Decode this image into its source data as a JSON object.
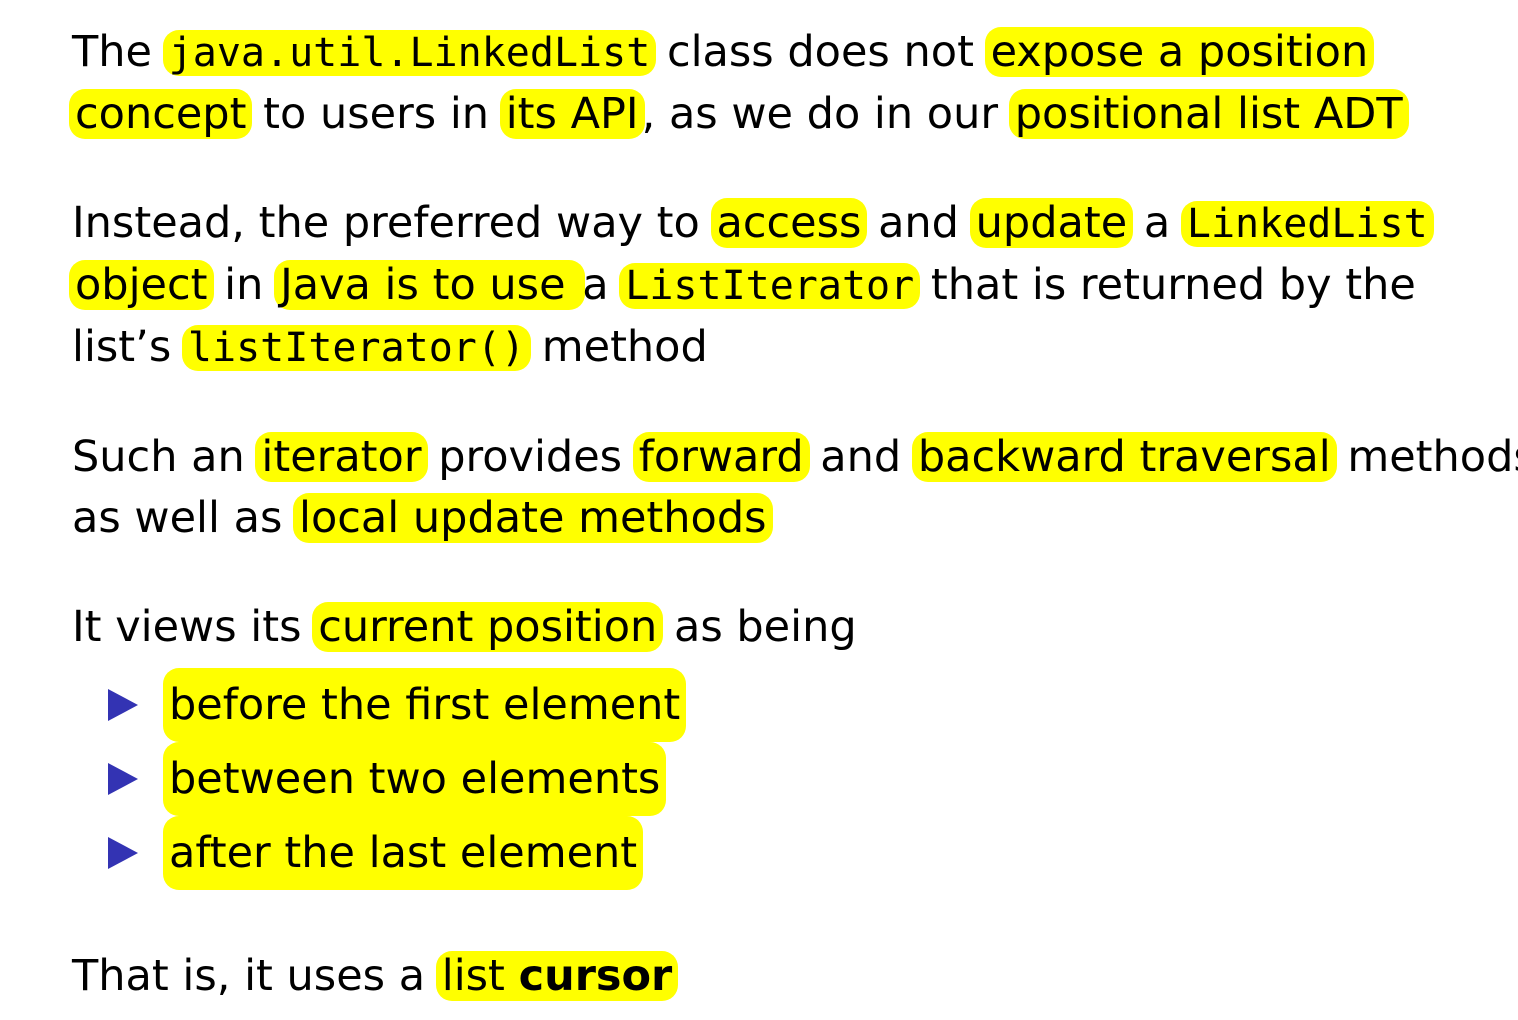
{
  "p1": {
    "t1": "The ",
    "h1": "java.util.LinkedList",
    "t2": " class does not ",
    "h2": "expose a position",
    "h3": "concept",
    "t3": " to users in ",
    "h4": "its API",
    "t4": ", as we do in our ",
    "h5": "positional list ADT"
  },
  "p2": {
    "t1": "Instead, the preferred way to ",
    "h1": "access",
    "t2": " and ",
    "h2": "update",
    "t3": " a ",
    "h3": "LinkedList",
    "h4": "object",
    "t4": " in ",
    "h5": "Java is to use ",
    "t5": "a ",
    "h6": "ListIterator",
    "t6": " that is returned by the",
    "t7": "list’s ",
    "h7": "listIterator()",
    "t8": " method"
  },
  "p3": {
    "t1": "Such an ",
    "h1": "iterator",
    "t2": " provides ",
    "h2": "forward",
    "t3": " and ",
    "h3": "backward traversal",
    "t4": " methods",
    "t5": "as well as ",
    "h4": "local update methods"
  },
  "p4": {
    "t1": "It views its ",
    "h1": "current position",
    "t2": " as being",
    "bullets": [
      "before the first element",
      "between two elements",
      "after the last element"
    ]
  },
  "p5": {
    "t1": "That is, it uses a ",
    "h1": "list ",
    "h2": "cursor"
  }
}
